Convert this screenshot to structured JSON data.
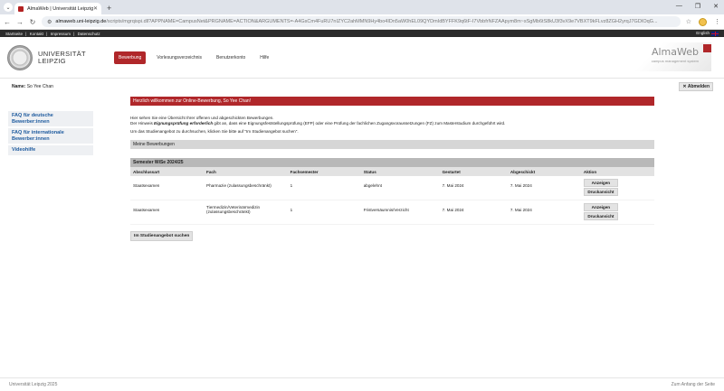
{
  "browser": {
    "tab_title": "AlmaWeb | Universität Leipzig",
    "url_host": "almaweb.uni-leipzig.de",
    "url_path": "/scripts/mgrqispi.dll?APPNAME=CampusNet&PRGNAME=ACTION&ARGUMENTS=-A4GsCm4FuRU7nIZYC2ahMMN9Hy4bo4IDn5aW0hEL09QYDmIdBYFFK9q6tF-I7VbbfrNFZAApym8m~sSgMb6tS8kU3f3vX9e7VBXT9kFLvz8ZGH2yrqJ7GDIOqG..."
  },
  "site": {
    "top_links": [
      "Startseite",
      "|",
      "Kontakt",
      "|",
      "Impressum",
      "|",
      "Datenschutz"
    ],
    "language": "English",
    "uni_name_line1": "UNIVERSITÄT",
    "uni_name_line2": "LEIPZIG",
    "nav": [
      {
        "label": "Bewerbung",
        "active": true
      },
      {
        "label": "Vorlesungsverzeichnis",
        "active": false
      },
      {
        "label": "Benutzerkonto",
        "active": false
      },
      {
        "label": "Hilfe",
        "active": false
      }
    ],
    "brand": "AlmaWeb",
    "brand_sub": "campus management system"
  },
  "user": {
    "name_label": "Name:",
    "name_value": "So Yee Chan",
    "logout_label": "Abmelden"
  },
  "sidebar": {
    "items": [
      {
        "label": "FAQ für deutsche Bewerber:innen"
      },
      {
        "label": "FAQ für internationale Bewerber:innen"
      },
      {
        "label": "Videohilfe"
      }
    ]
  },
  "main": {
    "welcome": "Herzlich willkommen zur Online-Bewerbung, So Yee Chan!",
    "intro_line1": "Hier sehen Sie eine Übersicht Ihrer offenen und abgeschickten Bewerbungen.",
    "intro_line2_pre": "Der Hinweis ",
    "intro_line2_em": "Eignungsprüfung erforderlich",
    "intro_line2_post": " gibt an, dass eine Eignungsfeststellungsprüfung (EFP) oder eine Prüfung der fachlichen Zugangsvoraussetzungen (FZ) zum Masterstudium durchgeführt wird.",
    "intro_line3": "Um das Studienangebot zu durchsuchen, klicken Sie bitte auf \"Im Studienangebot suchen\".",
    "section_title": "Meine Bewerbungen",
    "semester": "Semester WiSe 2024/25",
    "columns": [
      "Abschlussart",
      "Fach",
      "Fachsemester",
      "Status",
      "Gestartet",
      "Abgeschickt",
      "Aktion"
    ],
    "rows": [
      {
        "abschluss": "Staatsexamen",
        "fach": "Pharmazie (zulassungsbeschränkt)",
        "fachsemester": "1",
        "status": "abgelehnt",
        "gestartet": "7. Mai 2024",
        "abgeschickt": "7. Mai 2024",
        "btn1": "Anzeigen",
        "btn2": "Druckansicht"
      },
      {
        "abschluss": "Staatsexamen",
        "fach": "Tiermedizin/Veterinärmedizin (zulassungsbeschränkt)",
        "fachsemester": "1",
        "status": "Fristversäumnis/Verzicht",
        "gestartet": "7. Mai 2024",
        "abgeschickt": "7. Mai 2024",
        "btn1": "Anzeigen",
        "btn2": "Druckansicht"
      }
    ],
    "search_button": "Im Studienangebot suchen"
  },
  "footer": {
    "left": "Universität Leipzig 2025",
    "right": "Zum Anfang der Seite"
  },
  "colors": {
    "accent": "#b0272a",
    "link": "#1d5a9e"
  }
}
